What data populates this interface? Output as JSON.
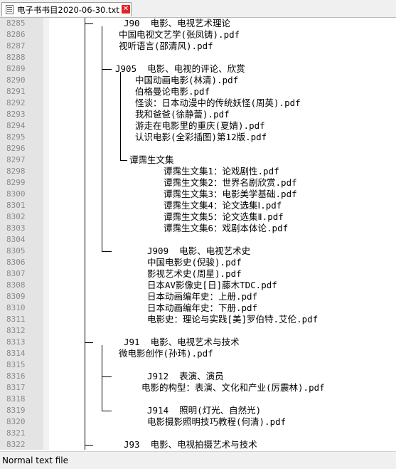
{
  "tab": {
    "title": "电子书书目2020-06-30.txt",
    "close_label": "✕"
  },
  "status_bar": {
    "file_type": "Normal text file"
  },
  "editor": {
    "lines": [
      {
        "num": "8285",
        "text": "J90  电影、电视艺术理论"
      },
      {
        "num": "8286",
        "text": "中国电视文艺学(张凤铸).pdf"
      },
      {
        "num": "8287",
        "text": "视听语言(邵清风).pdf"
      },
      {
        "num": "8288",
        "text": ""
      },
      {
        "num": "8289",
        "text": "J905  电影、电视的评论、欣赏"
      },
      {
        "num": "8290",
        "text": "中国动画电影(林清).pdf"
      },
      {
        "num": "8291",
        "text": "伯格曼论电影.pdf"
      },
      {
        "num": "8292",
        "text": "怪谈：日本动漫中的传统妖怪(周英).pdf"
      },
      {
        "num": "8293",
        "text": "我和爸爸(徐静蕾).pdf"
      },
      {
        "num": "8294",
        "text": "游走在电影里的重庆(夏婧).pdf"
      },
      {
        "num": "8295",
        "text": "认识电影(全彩插图)第12版.pdf"
      },
      {
        "num": "8296",
        "text": ""
      },
      {
        "num": "8297",
        "text": "谭霈生文集"
      },
      {
        "num": "8298",
        "text": "谭霈生文集1：论戏剧性.pdf"
      },
      {
        "num": "8299",
        "text": "谭霈生文集2：世界名剧欣赏.pdf"
      },
      {
        "num": "8300",
        "text": "谭霈生文集3：电影美学基础.pdf"
      },
      {
        "num": "8301",
        "text": "谭霈生文集4：论文选集Ⅰ.pdf"
      },
      {
        "num": "8302",
        "text": "谭霈生文集5：论文选集Ⅱ.pdf"
      },
      {
        "num": "8303",
        "text": "谭霈生文集6：戏剧本体论.pdf"
      },
      {
        "num": "8304",
        "text": ""
      },
      {
        "num": "8305",
        "text": "J909  电影、电视艺术史"
      },
      {
        "num": "8306",
        "text": "中国电影史(倪骏).pdf"
      },
      {
        "num": "8307",
        "text": "影视艺术史(周星).pdf"
      },
      {
        "num": "8308",
        "text": "日本AV影像史[日]藤木TDC.pdf"
      },
      {
        "num": "8309",
        "text": "日本动画编年史：上册.pdf"
      },
      {
        "num": "8310",
        "text": "日本动画编年史：下册.pdf"
      },
      {
        "num": "8311",
        "text": "电影史：理论与实践[美]罗伯特.艾伦.pdf"
      },
      {
        "num": "8312",
        "text": ""
      },
      {
        "num": "8313",
        "text": "J91  电影、电视艺术与技术"
      },
      {
        "num": "8314",
        "text": "微电影创作(孙玮).pdf"
      },
      {
        "num": "8315",
        "text": ""
      },
      {
        "num": "8316",
        "text": "J912  表演、演员"
      },
      {
        "num": "8317",
        "text": "电影的构型：表演、文化和产业(厉震林).pdf"
      },
      {
        "num": "8318",
        "text": ""
      },
      {
        "num": "8319",
        "text": "J914  照明(灯光、自然光)"
      },
      {
        "num": "8320",
        "text": "电影摄影照明技巧教程(何清).pdf"
      },
      {
        "num": "8321",
        "text": ""
      },
      {
        "num": "8322",
        "text": "J93  电影、电视拍摄艺术与技术"
      }
    ]
  }
}
